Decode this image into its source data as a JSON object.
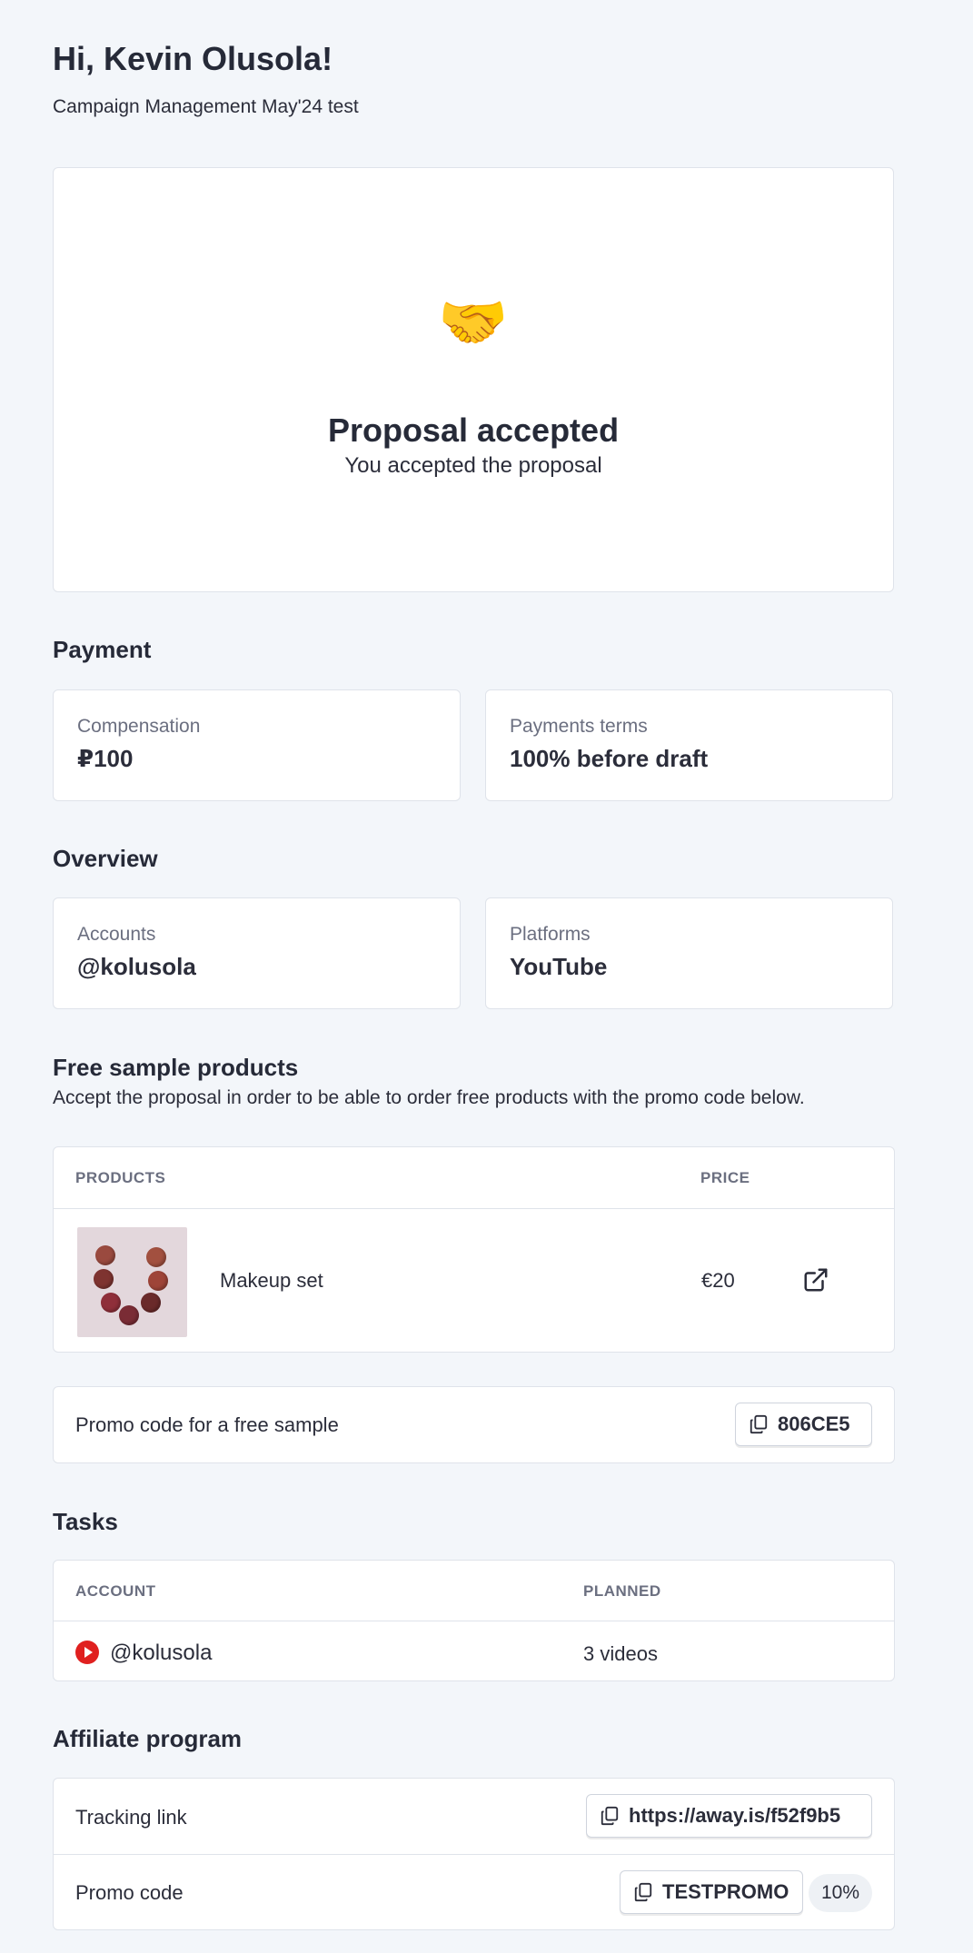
{
  "header": {
    "greeting": "Hi, Kevin Olusola!",
    "campaign": "Campaign Management May'24 test"
  },
  "status": {
    "icon": "handshake-icon",
    "icon_glyph": "🤝",
    "title": "Proposal accepted",
    "subtitle": "You accepted the proposal"
  },
  "payment": {
    "title": "Payment",
    "compensation_label": "Compensation",
    "compensation_value": "₽100",
    "terms_label": "Payments terms",
    "terms_value": "100% before draft"
  },
  "overview": {
    "title": "Overview",
    "accounts_label": "Accounts",
    "accounts_value": "@kolusola",
    "platforms_label": "Platforms",
    "platforms_value": "YouTube"
  },
  "samples": {
    "title": "Free sample products",
    "description": "Accept the proposal in order to be able to order free products with the promo code below.",
    "col_products": "PRODUCTS",
    "col_price": "PRICE",
    "rows": [
      {
        "name": "Makeup set",
        "price": "€20"
      }
    ],
    "promo_label": "Promo code for a free sample",
    "promo_code": "806CE5"
  },
  "tasks": {
    "title": "Tasks",
    "col_account": "ACCOUNT",
    "col_planned": "PLANNED",
    "rows": [
      {
        "account": "@kolusola",
        "planned": "3 videos"
      }
    ]
  },
  "affiliate": {
    "title": "Affiliate program",
    "tracking_label": "Tracking link",
    "tracking_link": "https://away.is/f52f9b5",
    "promo_label": "Promo code",
    "promo_code": "TESTPROMO",
    "promo_discount": "10%"
  },
  "colors": {
    "background": "#f3f6fa",
    "card": "#ffffff",
    "border": "#dfe3ea",
    "text": "#2b2d3a",
    "muted": "#6b6f80",
    "youtube_red": "#e0201f"
  }
}
